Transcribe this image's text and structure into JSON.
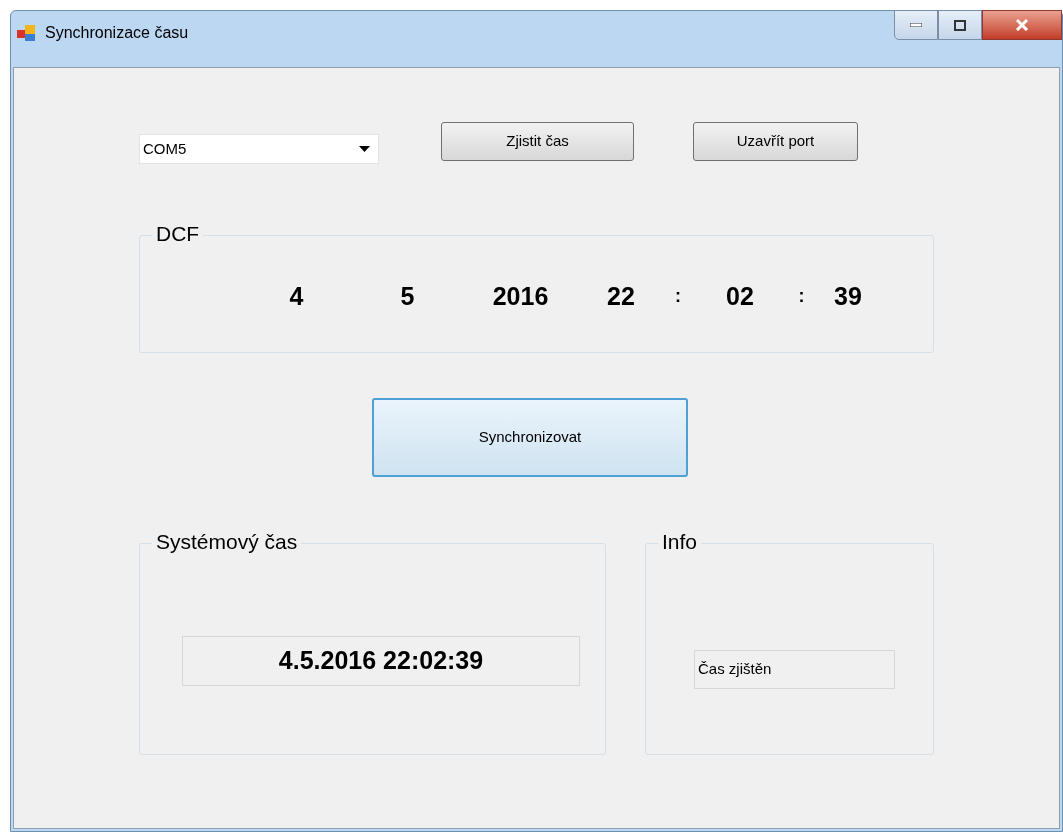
{
  "window": {
    "title": "Synchronizace času"
  },
  "port_select": {
    "value": "COM5"
  },
  "buttons": [
    {
      "label": "Zjistit čas"
    },
    {
      "label": "Uzavřít port"
    }
  ],
  "dcf": {
    "title": "DCF",
    "parts": [
      {
        "kind": "value",
        "text": "4"
      },
      {
        "kind": "value",
        "text": "5"
      },
      {
        "kind": "value",
        "text": "2016"
      },
      {
        "kind": "value",
        "text": "22"
      },
      {
        "kind": "separator",
        "text": ":"
      },
      {
        "kind": "value",
        "text": "02"
      },
      {
        "kind": "separator",
        "text": ":"
      },
      {
        "kind": "value",
        "text": "39"
      }
    ]
  },
  "sync_button": {
    "label": "Synchronizovat"
  },
  "system_time": {
    "title": "Systémový čas",
    "value": "4.5.2016 22:02:39"
  },
  "info": {
    "title": "Info",
    "value": "Čas zjištěn"
  }
}
